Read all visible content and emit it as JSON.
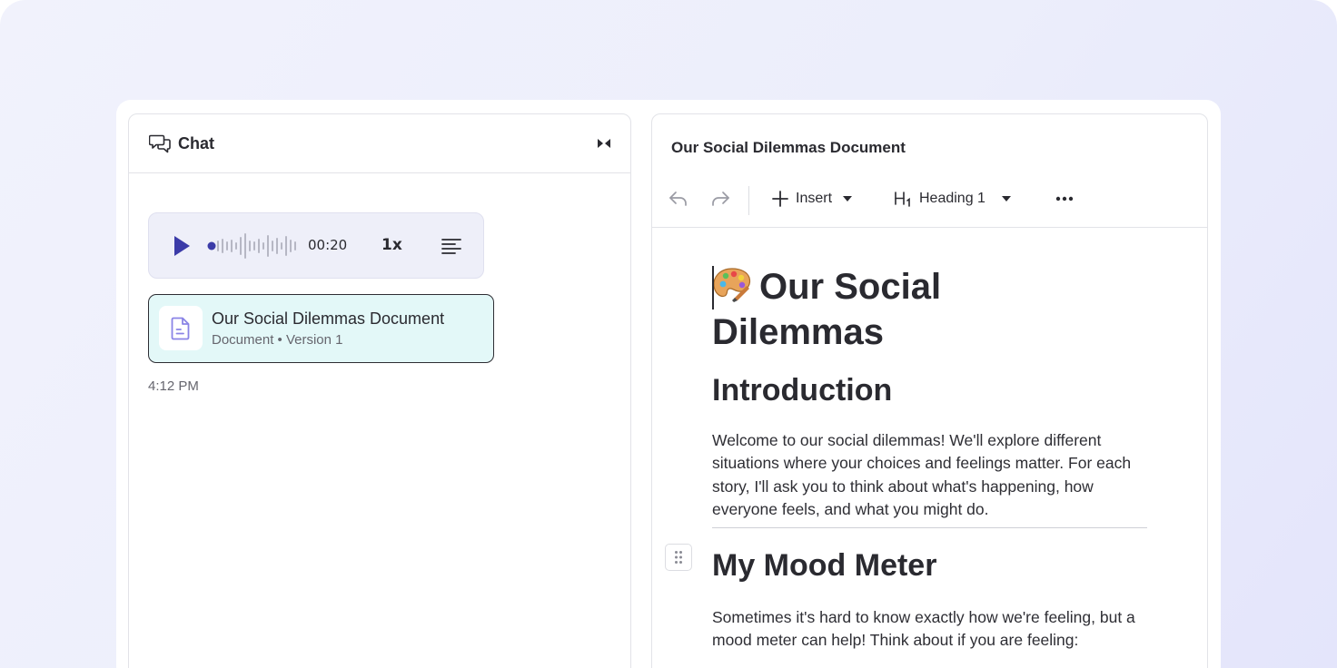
{
  "chat": {
    "title": "Chat",
    "audio": {
      "time": "00:20",
      "speed": "1x"
    },
    "document_card": {
      "title": "Our Social Dilemmas Document",
      "subtitle": "Document • Version 1"
    },
    "timestamp": "4:12 PM"
  },
  "document": {
    "header_title": "Our Social Dilemmas Document",
    "toolbar": {
      "insert_label": "Insert",
      "heading_label": "Heading 1"
    },
    "title": "Our Social Dilemmas",
    "sections": [
      {
        "heading": "Introduction",
        "text": "Welcome to our social dilemmas! We'll explore different situations where your choices and feelings matter. For each story, I'll ask you to think about what's happening, how everyone feels, and what you might do."
      },
      {
        "heading": "My Mood Meter",
        "text": "Sometimes it's hard to know exactly how we're feeling, but a mood meter can help! Think about if you are feeling:"
      }
    ]
  },
  "icons": {
    "chat": "chat-bubbles-icon",
    "collapse": "collapse-panel-icon",
    "play": "play-icon",
    "transcript": "transcript-lines-icon",
    "doc": "document-icon",
    "undo": "undo-icon",
    "redo": "redo-icon",
    "insert": "plus-icon",
    "heading": "heading-icon",
    "more": "more-dots-icon",
    "drag": "drag-handle-icon",
    "emoji": "artist-palette-icon"
  },
  "colors": {
    "accent": "#3b3ba8",
    "card_bg": "#e3f8f8",
    "audio_bg": "#eeeff9",
    "doc_icon": "#8a84e6"
  }
}
